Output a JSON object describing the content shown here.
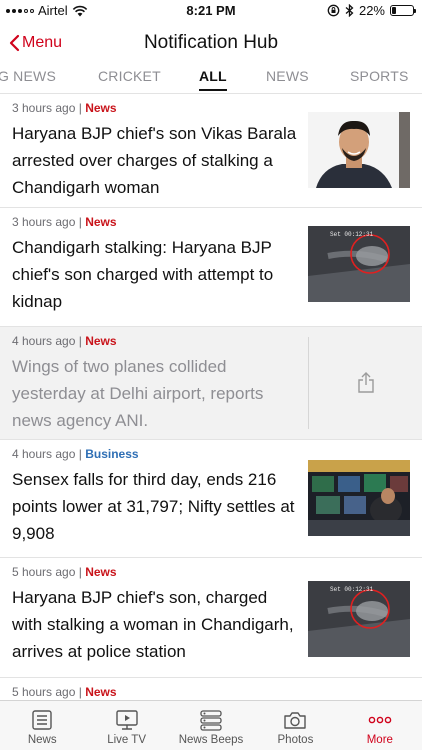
{
  "status_bar": {
    "carrier": "Airtel",
    "time": "8:21 PM",
    "battery_percent": "22%",
    "battery_level": 0.22
  },
  "nav": {
    "back_label": "Menu",
    "title": "Notification Hub"
  },
  "tabs": [
    {
      "label": "G NEWS"
    },
    {
      "label": "CRICKET"
    },
    {
      "label": "ALL",
      "active": true
    },
    {
      "label": "NEWS"
    },
    {
      "label": "SPORTS"
    }
  ],
  "notifications": [
    {
      "time": "3 hours ago",
      "category": "News",
      "headline": "Haryana BJP chief's son Vikas Barala arrested over charges of stalking a Chandigarh woman",
      "thumbnail": "portrait-photo"
    },
    {
      "time": "3 hours ago",
      "category": "News",
      "headline": "Chandigarh stalking: Haryana BJP chief's son charged with attempt to kidnap",
      "thumbnail": "cctv-photo",
      "thumb_overlay_text": "Set 00:12:31"
    },
    {
      "time": "4 hours ago",
      "category": "News",
      "headline": "Wings of two planes collided yesterday at Delhi airport, reports news agency ANI.",
      "read": true,
      "action_icon": "share-icon"
    },
    {
      "time": "4 hours ago",
      "category": "Business",
      "headline": "Sensex falls for third day, ends 216 points lower at 31,797; Nifty settles at 9,908",
      "thumbnail": "trading-floor-photo"
    },
    {
      "time": "5 hours ago",
      "category": "News",
      "headline": "Haryana BJP chief's son, charged with stalking a woman in Chandigarh, arrives at police station",
      "thumbnail": "cctv-photo",
      "thumb_overlay_text": "Set 00:12:31"
    },
    {
      "time": "5 hours ago",
      "category": "News"
    }
  ],
  "tabbar": [
    {
      "label": "News",
      "icon": "news-icon"
    },
    {
      "label": "Live TV",
      "icon": "live-tv-icon"
    },
    {
      "label": "News Beeps",
      "icon": "news-beeps-icon"
    },
    {
      "label": "Photos",
      "icon": "camera-icon"
    },
    {
      "label": "More",
      "icon": "more-icon",
      "active": true
    }
  ],
  "colors": {
    "accent": "#d0021b",
    "category_news": "#c9141b",
    "category_business": "#2f6fb5",
    "read_background": "#f2f2f2"
  }
}
